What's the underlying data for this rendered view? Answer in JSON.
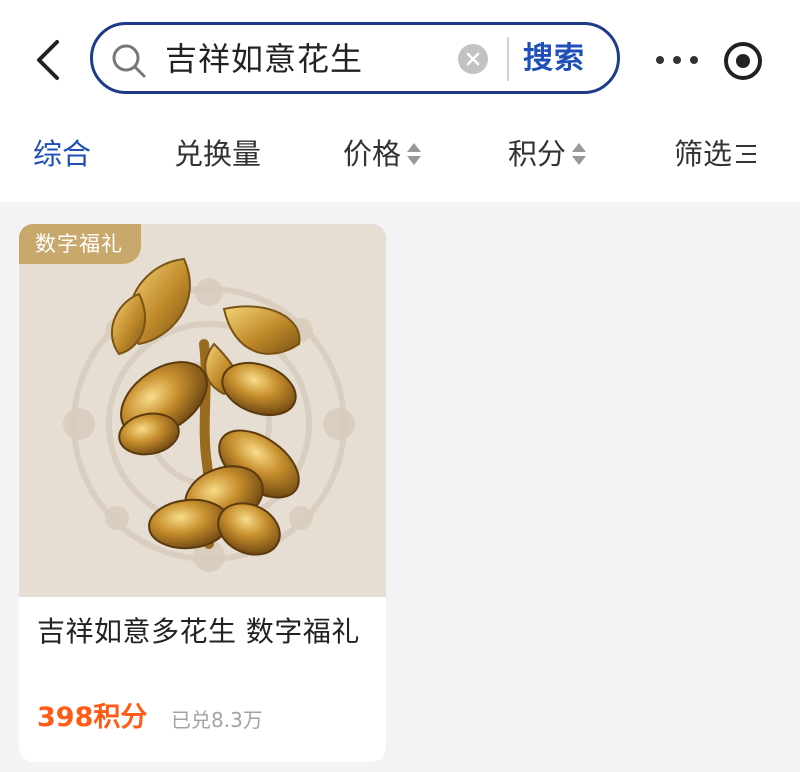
{
  "header": {
    "search": {
      "query": "吉祥如意花生",
      "button_label": "搜索"
    }
  },
  "sort_bar": {
    "items": [
      {
        "label": "综合"
      },
      {
        "label": "兑换量"
      },
      {
        "label": "价格"
      },
      {
        "label": "积分"
      },
      {
        "label": "筛选"
      }
    ]
  },
  "products": [
    {
      "badge": "数字福礼",
      "title": "吉祥如意多花生 数字福礼",
      "price": "398积分",
      "sold": "已兑8.3万",
      "image_icon": "golden-peanut-branch"
    }
  ],
  "colors": {
    "accent": "#1f4fb8",
    "search_border": "#1e3a8a",
    "price": "#ff5b14",
    "badge": "#c8a86b",
    "image_bg": "#e6ded3",
    "page_bg": "#f3f3f5"
  }
}
